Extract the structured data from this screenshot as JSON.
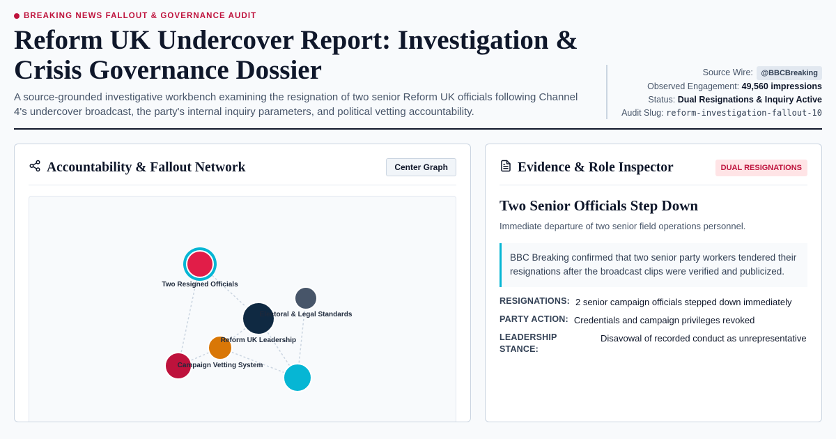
{
  "header": {
    "kicker": "BREAKING NEWS FALLOUT & GOVERNANCE AUDIT",
    "title": "Reform UK Undercover Report: Investigation & Crisis Governance Dossier",
    "subtitle": "A source-grounded investigative workbench examining the resignation of two senior Reform UK officials following Channel 4's undercover broadcast, the party's internal inquiry parameters, and political vetting accountability."
  },
  "meta": {
    "source_label": "Source Wire:",
    "source_value": "@BBCBreaking",
    "engagement_label": "Observed Engagement:",
    "engagement_value": "49,560 impressions",
    "status_label": "Status:",
    "status_value": "Dual Resignations & Inquiry Active",
    "slug_label": "Audit Slug:",
    "slug_value": "reform-investigation-fallout-10"
  },
  "network_panel": {
    "title": "Accountability & Fallout Network",
    "icon": "share-icon",
    "center_button": "Center Graph",
    "nodes": [
      {
        "id": "officials",
        "label": "Two Resigned Officials",
        "color": "#e11d48",
        "ring": "#06b6d4",
        "selected": true
      },
      {
        "id": "leadership",
        "label": "Reform UK Leadership",
        "color": "#0f2942"
      },
      {
        "id": "standards",
        "label": "Electoral & Legal Standards",
        "color": "#475569"
      },
      {
        "id": "vetting",
        "label": "Campaign Vetting System",
        "color": "#d97706"
      },
      {
        "id": "broadcast",
        "label": "",
        "color": "#be123c"
      },
      {
        "id": "inquiry",
        "label": "",
        "color": "#06b6d4"
      }
    ]
  },
  "inspector": {
    "title": "Evidence & Role Inspector",
    "icon": "document-icon",
    "badge": "DUAL RESIGNATIONS",
    "heading": "Two Senior Officials Step Down",
    "summary": "Immediate departure of two senior field operations personnel.",
    "quote": "BBC Breaking confirmed that two senior party workers tendered their resignations after the broadcast clips were verified and publicized.",
    "fields": [
      {
        "key": "RESIGNATIONS:",
        "value": "2 senior campaign officials stepped down immediately"
      },
      {
        "key": "PARTY ACTION:",
        "value": "Credentials and campaign privileges revoked"
      },
      {
        "key": "LEADERSHIP STANCE:",
        "value": "Disavowal of recorded conduct as unrepresentative"
      }
    ]
  },
  "colors": {
    "accent": "#be123c",
    "ink": "#0f172a",
    "cyan": "#06b6d4"
  }
}
